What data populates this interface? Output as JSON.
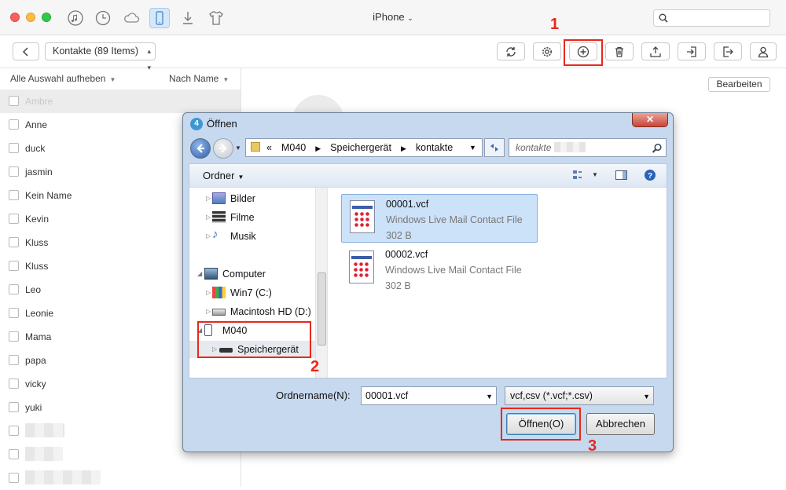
{
  "window": {
    "device_title": "iPhone"
  },
  "top_nav": {
    "icons": [
      "music-icon",
      "history-icon",
      "cloud-icon",
      "phone-icon",
      "download-icon",
      "shirt-icon"
    ]
  },
  "toolbar": {
    "category_select": "Kontakte (89 Items)"
  },
  "annotations": {
    "step1": "1",
    "step2": "2",
    "step3": "3",
    "highlight_color": "#e8281a"
  },
  "list": {
    "select_toggle": "Alle Auswahl aufheben",
    "sort": "Nach Name",
    "contacts": [
      "Ambre",
      "Anne",
      "duck",
      "jasmin",
      "Kein Name",
      "Kevin",
      "Kluss",
      "Kluss",
      "Leo",
      "Leonie",
      "Mama",
      "papa",
      "vicky",
      "yuki"
    ]
  },
  "detail": {
    "edit_button": "Bearbeiten"
  },
  "dialog": {
    "title": "Öffnen",
    "close": "✕",
    "path": {
      "prefix": "«",
      "segments": [
        "M040",
        "Speichergerät",
        "kontakte"
      ]
    },
    "search_placeholder": "kontakte",
    "organize": "Ordner",
    "nav_items": {
      "bilder": "Bilder",
      "filme": "Filme",
      "musik": "Musik",
      "computer": "Computer",
      "win7": "Win7 (C:)",
      "mac": "Macintosh HD (D:)",
      "m040": "M040",
      "speicher": "Speichergerät"
    },
    "files": [
      {
        "name": "00001.vcf",
        "type": "Windows Live Mail Contact File",
        "size": "302 B"
      },
      {
        "name": "00002.vcf",
        "type": "Windows Live Mail Contact File",
        "size": "302 B"
      }
    ],
    "filename_label": "Ordnername(N):",
    "filename_value": "00001.vcf",
    "filetype": "vcf,csv (*.vcf;*.csv)",
    "open_button": "Öffnen(O)",
    "cancel_button": "Abbrechen"
  }
}
